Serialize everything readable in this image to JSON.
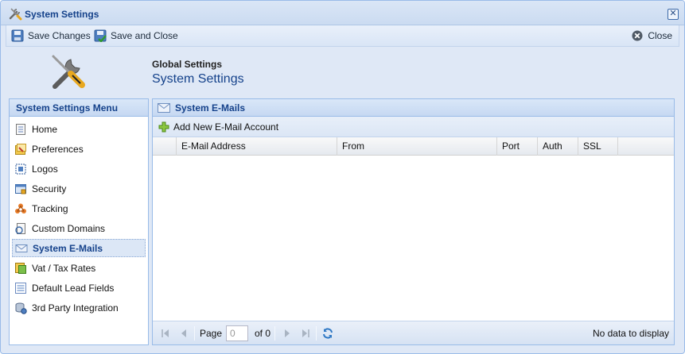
{
  "window": {
    "title": "System Settings",
    "close_symbol": "✕"
  },
  "toolbar": {
    "save_changes_label": "Save Changes",
    "save_and_close_label": "Save and Close",
    "close_label": "Close"
  },
  "header": {
    "subtitle": "Global Settings",
    "title": "System Settings",
    "icon": "tools-icon"
  },
  "sidebar": {
    "title": "System Settings Menu",
    "items": [
      {
        "label": "Home",
        "icon": "home-doc-icon"
      },
      {
        "label": "Preferences",
        "icon": "preferences-icon"
      },
      {
        "label": "Logos",
        "icon": "logos-icon"
      },
      {
        "label": "Security",
        "icon": "security-icon"
      },
      {
        "label": "Tracking",
        "icon": "tracking-icon"
      },
      {
        "label": "Custom Domains",
        "icon": "custom-domains-icon"
      },
      {
        "label": "System E-Mails",
        "icon": "envelope-icon",
        "selected": true
      },
      {
        "label": "Vat / Tax Rates",
        "icon": "tax-rates-icon"
      },
      {
        "label": "Default Lead Fields",
        "icon": "lead-fields-icon"
      },
      {
        "label": "3rd Party Integration",
        "icon": "integration-icon"
      }
    ]
  },
  "main": {
    "title": "System E-Mails",
    "add_button_label": "Add New E-Mail Account",
    "columns": [
      "E-Mail Address",
      "From",
      "Port",
      "Auth",
      "SSL"
    ],
    "rows": []
  },
  "paging": {
    "page_label": "Page",
    "page_value": "0",
    "of_label": "of 0",
    "status": "No data to display"
  },
  "colors": {
    "accent_text": "#15428b",
    "panel_border": "#99bbe8",
    "window_bg": "#dfe8f6"
  }
}
